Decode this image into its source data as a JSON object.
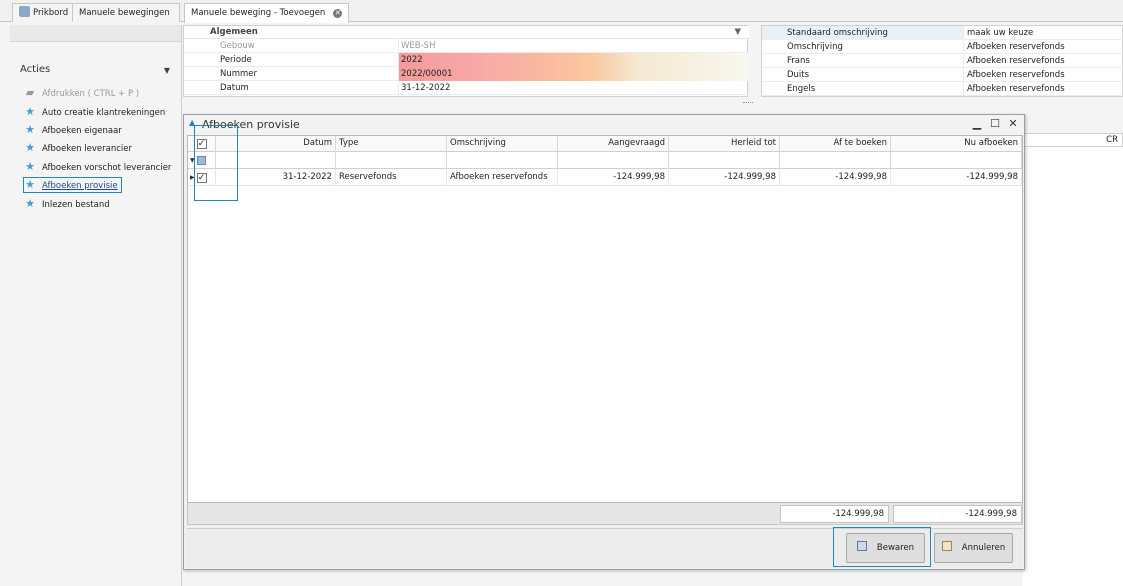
{
  "tabs": [
    {
      "label": "Prikbord"
    },
    {
      "label": "Manuele bewegingen"
    },
    {
      "label": "Manuele beweging - Toevoegen"
    }
  ],
  "sidebar": {
    "title": "Acties",
    "items": [
      {
        "label": "Afdrukken ( CTRL + P )",
        "state": "disabled"
      },
      {
        "label": "Auto creatie klantrekeningen",
        "state": "normal"
      },
      {
        "label": "Afboeken eigenaar",
        "state": "normal"
      },
      {
        "label": "Afboeken leverancier",
        "state": "normal"
      },
      {
        "label": "Afboeken vorschot leverancier",
        "state": "normal"
      },
      {
        "label": "Afboeken provisie",
        "state": "selected"
      },
      {
        "label": "Inlezen bestand",
        "state": "normal"
      }
    ]
  },
  "general": {
    "title": "Algemeen",
    "fields": [
      {
        "label": "Gebouw",
        "value": "WEB-SH"
      },
      {
        "label": "Periode",
        "value": "2022"
      },
      {
        "label": "Nummer",
        "value": "2022/00001"
      },
      {
        "label": "Datum",
        "value": "31-12-2022"
      }
    ]
  },
  "languages": [
    {
      "label": "Standaard omschrijving",
      "value": "maak uw keuze"
    },
    {
      "label": "Omschrijving",
      "value": "Afboeken reservefonds"
    },
    {
      "label": "Frans",
      "value": "Afboeken reservefonds"
    },
    {
      "label": "Duits",
      "value": "Afboeken reservefonds"
    },
    {
      "label": "Engels",
      "value": "Afboeken reservefonds"
    }
  ],
  "background_grid": {
    "col_cr": "CR"
  },
  "dialog": {
    "title": "Afboeken provisie",
    "controls": {
      "minimize": "▁",
      "maximize": "☐",
      "close": "✕"
    },
    "columns": {
      "datum": "Datum",
      "type": "Type",
      "omschrijving": "Omschrijving",
      "aangevraagd": "Aangevraagd",
      "herleid": "Herleid tot",
      "afteboeken": "Af te boeken",
      "nuafboeken": "Nu afboeken"
    },
    "rows": [
      {
        "checked": true,
        "datum": "31-12-2022",
        "type": "Reservefonds",
        "omschrijving": "Afboeken reservefonds",
        "aangevraagd": "-124.999,98",
        "herleid": "-124.999,98",
        "afteboeken": "-124.999,98",
        "nuafboeken": "-124.999,98"
      }
    ],
    "totals": {
      "afteboeken": "-124.999,98",
      "nuafboeken": "-124.999,98"
    },
    "buttons": {
      "save": "Bewaren",
      "cancel": "Annuleren"
    }
  }
}
